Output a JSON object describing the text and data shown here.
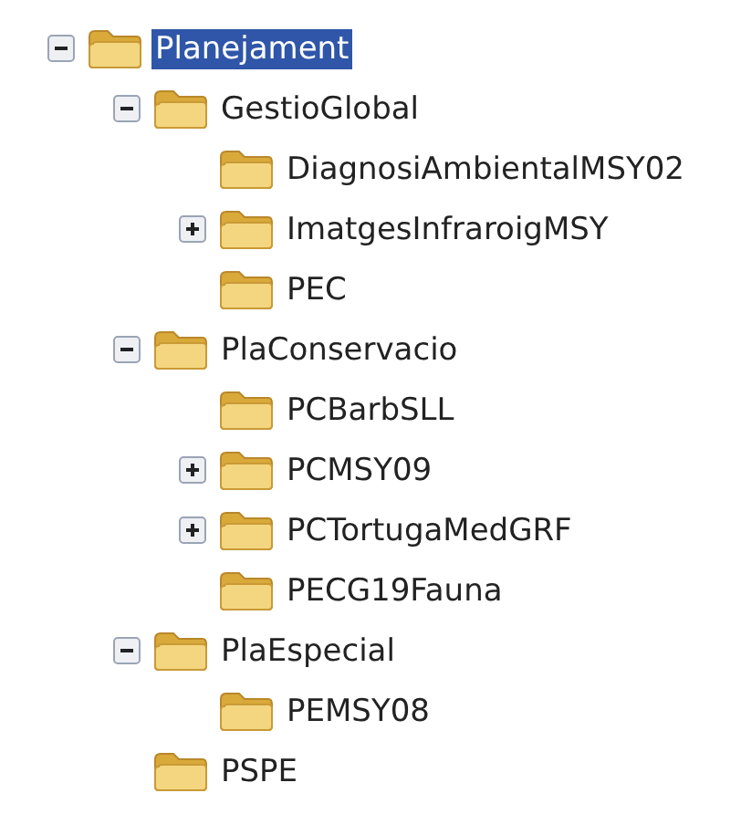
{
  "tree": [
    {
      "label": "Planejament",
      "selected": true,
      "expanded": true,
      "children": [
        {
          "label": "GestioGlobal",
          "selected": false,
          "expanded": true,
          "children": [
            {
              "label": "DiagnosiAmbientalMSY02",
              "selected": false
            },
            {
              "label": "ImatgesInfraroigMSY",
              "selected": false,
              "expanded": false
            },
            {
              "label": "PEC",
              "selected": false
            }
          ]
        },
        {
          "label": "PlaConservacio",
          "selected": false,
          "expanded": true,
          "children": [
            {
              "label": "PCBarbSLL",
              "selected": false
            },
            {
              "label": "PCMSY09",
              "selected": false,
              "expanded": false
            },
            {
              "label": "PCTortugaMedGRF",
              "selected": false,
              "expanded": false
            },
            {
              "label": "PECG19Fauna",
              "selected": false
            }
          ]
        },
        {
          "label": "PlaEspecial",
          "selected": false,
          "expanded": true,
          "children": [
            {
              "label": "PEMSY08",
              "selected": false
            }
          ]
        },
        {
          "label": "PSPE",
          "selected": false
        }
      ]
    }
  ]
}
